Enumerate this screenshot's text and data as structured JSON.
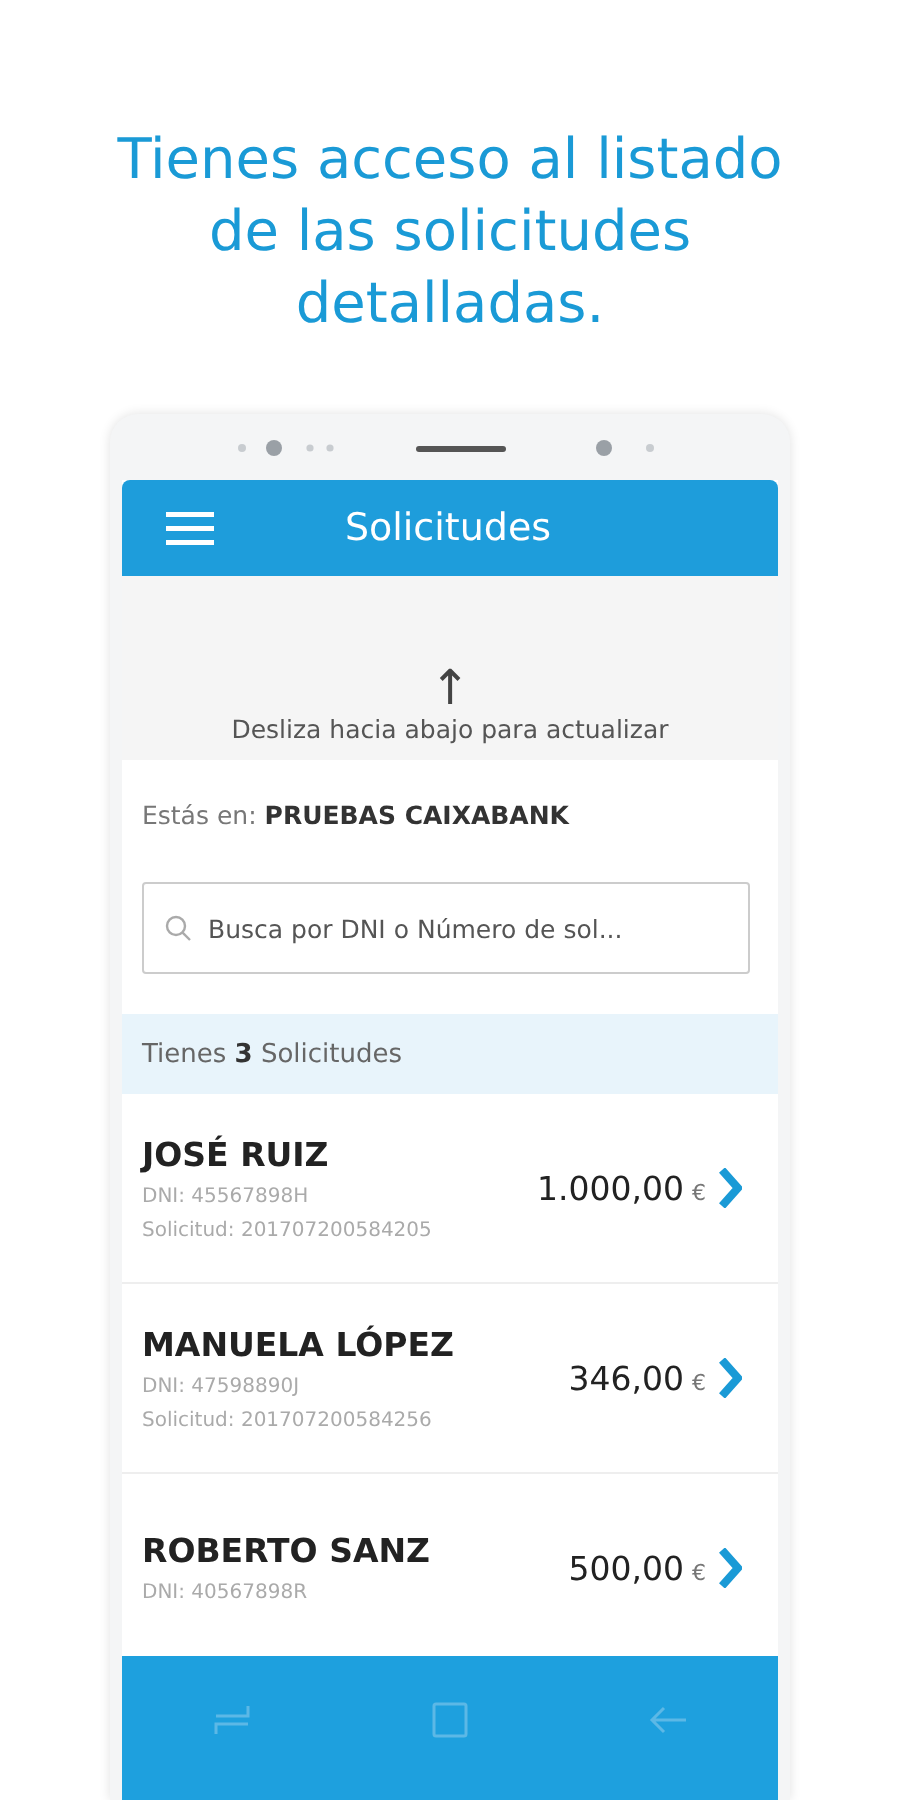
{
  "headline": "Tienes acceso al listado de las solicitudes detalladas.",
  "app_bar": {
    "title": "Solicitudes"
  },
  "refresh_hint": {
    "arrow": "↑",
    "text": "Desliza hacia abajo para actualizar"
  },
  "location": {
    "label": "Estás en:",
    "value": "PRUEBAS CAIXABANK"
  },
  "search": {
    "placeholder": "Busca por DNI o Número de sol..."
  },
  "summary": "Tienes **3** Solicitudes",
  "requests": [
    {
      "name": "JOSÉ RUIZ",
      "dni": "DNI: 45567898H",
      "solicitud": "Solicitud: 201707200584205",
      "amount": "1.000,00",
      "currency": "€"
    },
    {
      "name": "MANUELA LÓPEZ",
      "dni": "DNI: 47598890J",
      "solicitud": "Solicitud: 201707200584256",
      "amount": "346,00",
      "currency": "€"
    },
    {
      "name": "ROBERTO SANZ",
      "dni": "DNI: 40567898R",
      "amount": "500,00",
      "currency": "€"
    }
  ]
}
